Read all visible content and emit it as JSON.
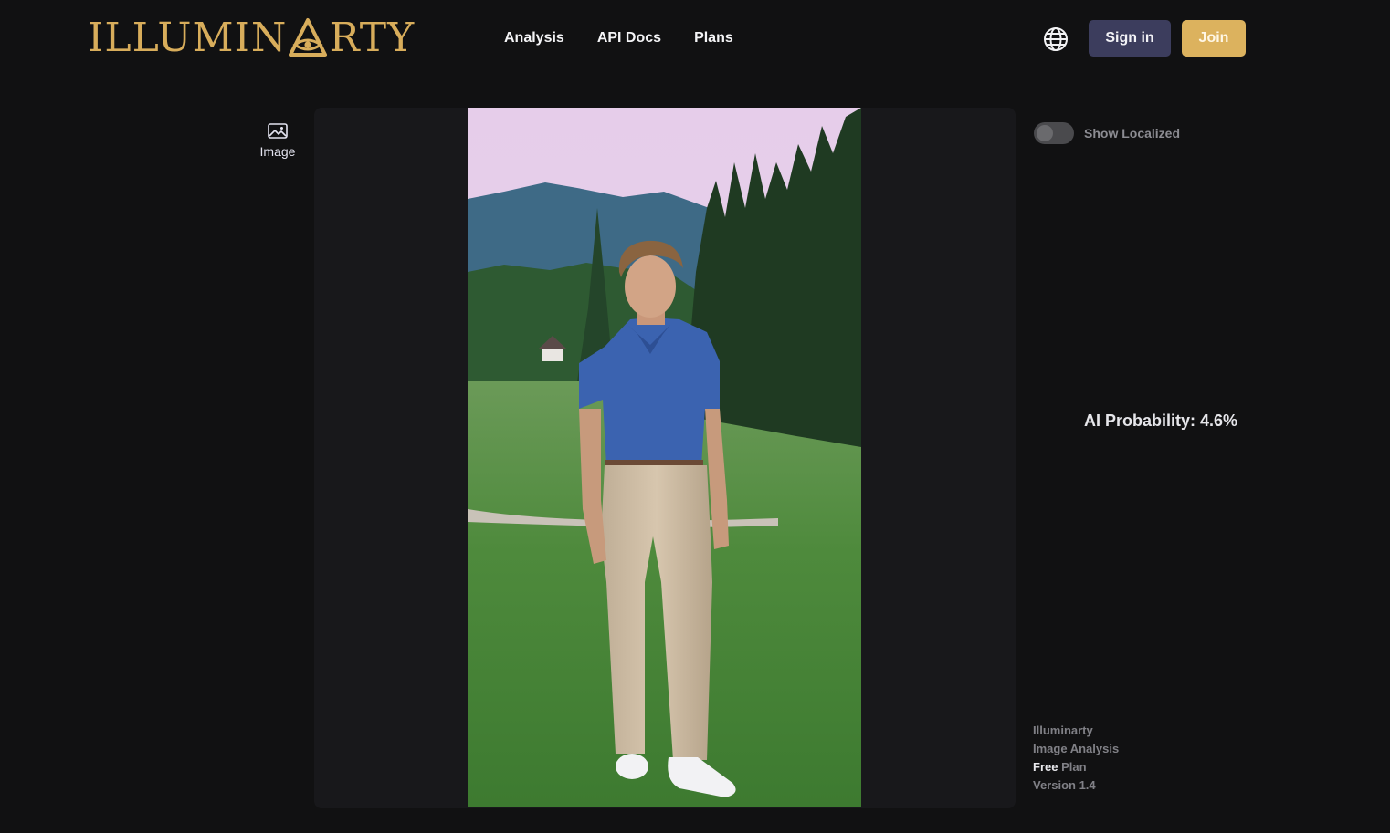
{
  "header": {
    "logo_text_left": "ILLUMIN",
    "logo_text_right": "RTY",
    "nav": [
      {
        "label": "Analysis"
      },
      {
        "label": "API Docs"
      },
      {
        "label": "Plans"
      }
    ],
    "language_icon": "globe-icon",
    "sign_in_label": "Sign in",
    "join_label": "Join"
  },
  "sidebar": {
    "tab_label": "Image",
    "tab_icon": "image-icon"
  },
  "result": {
    "toggle_label": "Show Localized",
    "toggle_on": false,
    "ai_probability_text": "AI Probability: 4.6%",
    "ai_probability": 0.046
  },
  "footer": {
    "line1": "Illuminarty",
    "line2": "Image Analysis",
    "plan_strong": "Free",
    "plan_rest": " Plan",
    "version": "Version 1.4"
  },
  "colors": {
    "background": "#111112",
    "panel": "#18181b",
    "brand_gold": "#d8ad5b",
    "sign_in_bg": "#3c3d5d",
    "join_bg": "#dcb25e"
  }
}
